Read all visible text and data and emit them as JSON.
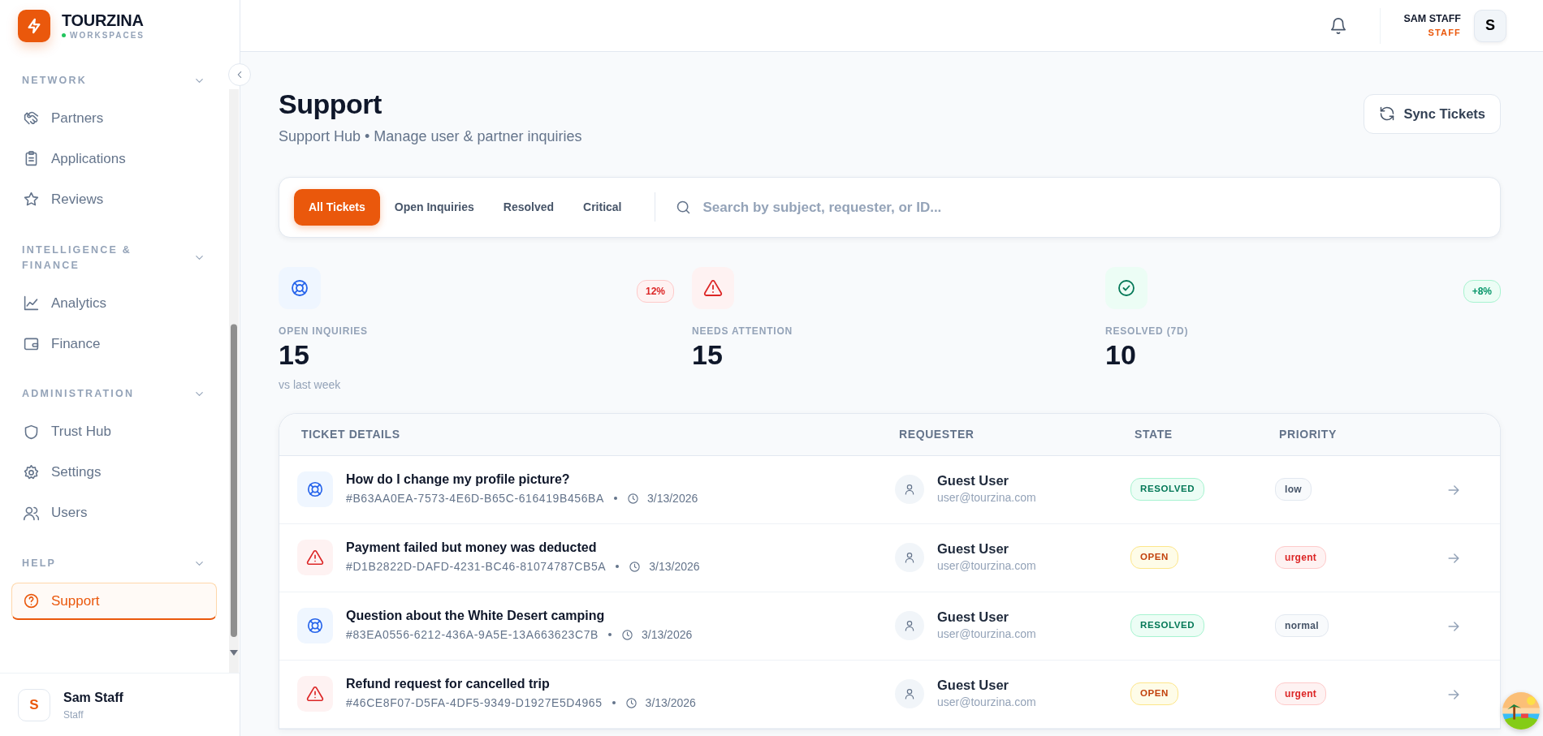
{
  "brand": {
    "name": "TOURZINA",
    "subtitle": "WORKSPACES"
  },
  "sidebar": {
    "groups": [
      {
        "title": "NETWORK",
        "items": [
          {
            "label": "Partners",
            "selected": false
          },
          {
            "label": "Applications",
            "selected": false
          },
          {
            "label": "Reviews",
            "selected": false
          }
        ]
      },
      {
        "title": "INTELLIGENCE & FINANCE",
        "items": [
          {
            "label": "Analytics",
            "selected": false
          },
          {
            "label": "Finance",
            "selected": false
          }
        ]
      },
      {
        "title": "ADMINISTRATION",
        "items": [
          {
            "label": "Trust Hub",
            "selected": false
          },
          {
            "label": "Settings",
            "selected": false
          },
          {
            "label": "Users",
            "selected": false
          }
        ]
      },
      {
        "title": "HELP",
        "items": [
          {
            "label": "Support",
            "selected": true
          }
        ]
      }
    ],
    "user": {
      "initial": "S",
      "name": "Sam Staff",
      "role": "Staff"
    }
  },
  "header": {
    "user_name": "SAM STAFF",
    "user_role": "STAFF",
    "avatar": "S"
  },
  "page": {
    "title": "Support",
    "subtitle": "Support Hub • Manage user & partner inquiries",
    "sync_button": "Sync Tickets"
  },
  "filters": {
    "tabs": [
      {
        "label": "All Tickets",
        "selected": true
      },
      {
        "label": "Open Inquiries",
        "selected": false
      },
      {
        "label": "Resolved",
        "selected": false
      },
      {
        "label": "Critical",
        "selected": false
      }
    ],
    "search": {
      "placeholder": "Search by subject, requester, or ID..."
    }
  },
  "stats": [
    {
      "kind": "info",
      "label": "OPEN INQUIRIES",
      "value": "15",
      "note": "vs last week",
      "trend": {
        "text": "12%",
        "kind": "down"
      }
    },
    {
      "kind": "danger",
      "label": "NEEDS ATTENTION",
      "value": "15"
    },
    {
      "kind": "success",
      "label": "RESOLVED (7D)",
      "value": "10",
      "trend": {
        "text": "+8%",
        "kind": "up"
      }
    }
  ],
  "table": {
    "columns": [
      "TICKET DETAILS",
      "REQUESTER",
      "STATE",
      "PRIORITY"
    ],
    "rows": [
      {
        "kind": "inquiry",
        "subject": "How do I change my profile picture?",
        "id": "#B63AA0EA-7573-4E6D-B65C-616419B456BA",
        "date": "3/13/2026",
        "requester_name": "Guest User",
        "requester_email": "user@tourzina.com",
        "state": {
          "text": "RESOLVED",
          "kind": "resolved"
        },
        "priority": {
          "text": "low",
          "kind": "low"
        }
      },
      {
        "kind": "alert",
        "subject": "Payment failed but money was deducted",
        "id": "#D1B2822D-DAFD-4231-BC46-81074787CB5A",
        "date": "3/13/2026",
        "requester_name": "Guest User",
        "requester_email": "user@tourzina.com",
        "state": {
          "text": "OPEN",
          "kind": "open"
        },
        "priority": {
          "text": "urgent",
          "kind": "urgent"
        }
      },
      {
        "kind": "inquiry",
        "subject": "Question about the White Desert camping",
        "id": "#83EA0556-6212-436A-9A5E-13A663623C7B",
        "date": "3/13/2026",
        "requester_name": "Guest User",
        "requester_email": "user@tourzina.com",
        "state": {
          "text": "RESOLVED",
          "kind": "resolved"
        },
        "priority": {
          "text": "normal",
          "kind": "normal"
        }
      },
      {
        "kind": "alert",
        "subject": "Refund request for cancelled trip",
        "id": "#46CE8F07-D5FA-4DF5-9349-D1927E5D4965",
        "date": "3/13/2026",
        "requester_name": "Guest User",
        "requester_email": "user@tourzina.com",
        "state": {
          "text": "OPEN",
          "kind": "open"
        },
        "priority": {
          "text": "urgent",
          "kind": "urgent"
        }
      }
    ]
  }
}
